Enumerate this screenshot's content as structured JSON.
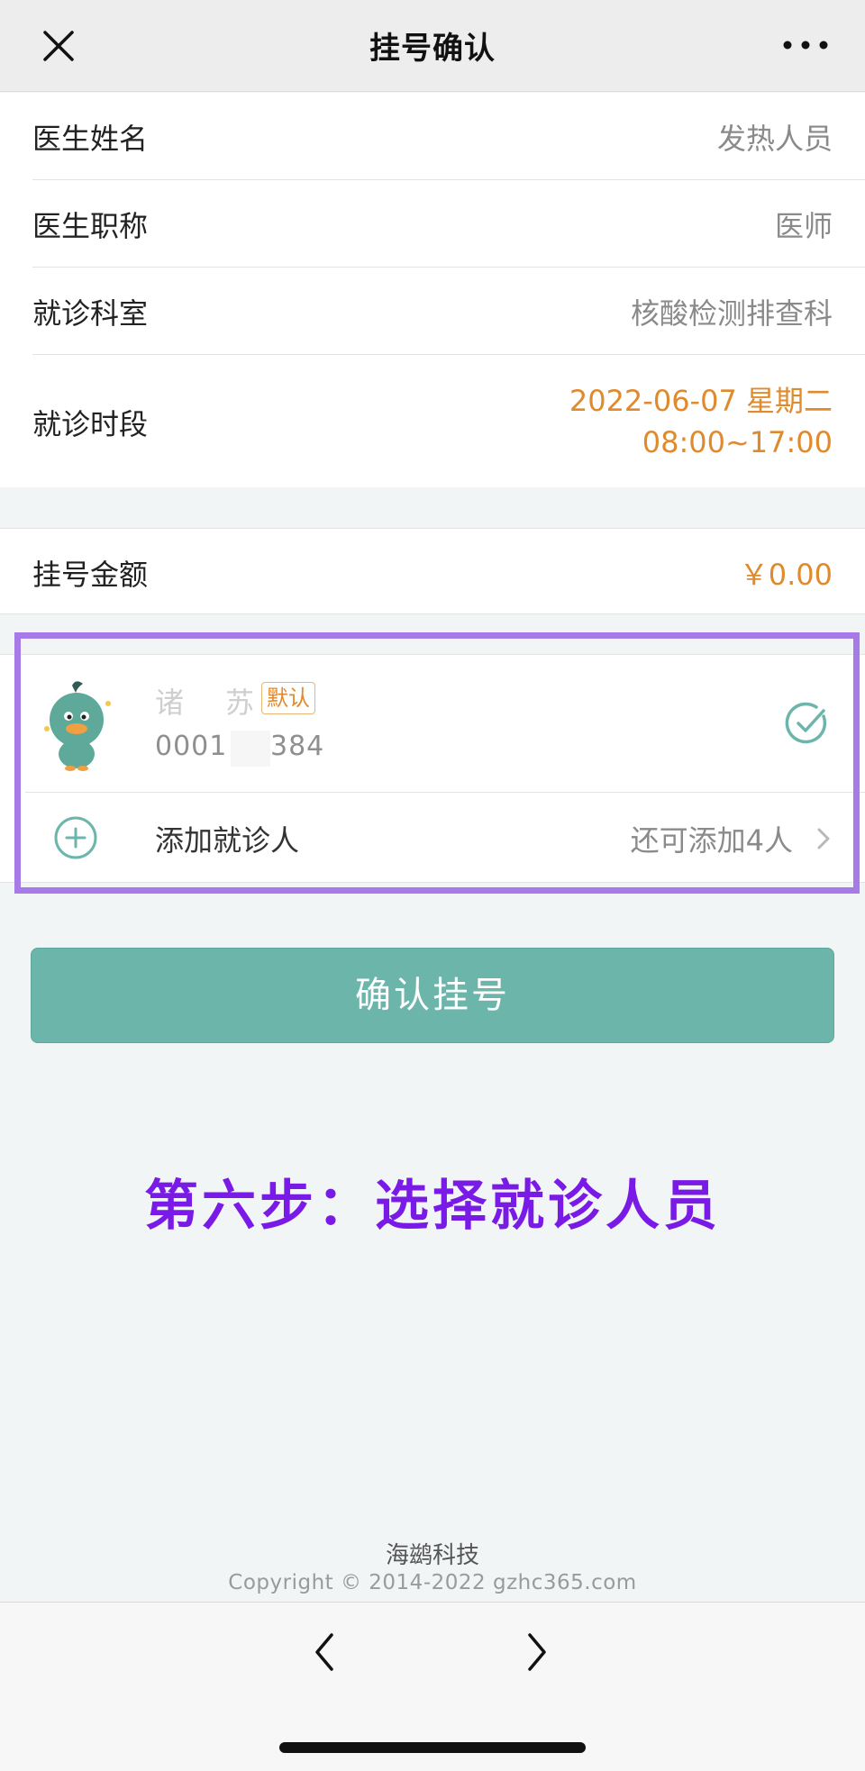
{
  "header": {
    "title": "挂号确认"
  },
  "details": [
    {
      "label": "医生姓名",
      "value": "发热人员"
    },
    {
      "label": "医生职称",
      "value": "医师"
    },
    {
      "label": "就诊科室",
      "value": "核酸检测排查科"
    }
  ],
  "time_slot": {
    "label": "就诊时段",
    "date": "2022-06-07 星期二",
    "hours": "08:00~17:00"
  },
  "fee": {
    "label": "挂号金额",
    "value": "￥0.00"
  },
  "patient": {
    "name_visible_first": "诸",
    "name_visible_last": "苏",
    "default_badge": "默认",
    "id_prefix": "0001",
    "id_suffix": "384"
  },
  "add_patient": {
    "label": "添加就诊人",
    "hint": "还可添加4人"
  },
  "confirm_button": "确认挂号",
  "annotation": "第六步：选择就诊人员",
  "footer": {
    "brand": "海鹚科技",
    "copyright": "Copyright © 2014-2022 gzhc365.com"
  },
  "colors": {
    "accent": "#6cb5ab",
    "highlight": "#e08a2e",
    "annotation": "#7a1ae6",
    "box_border": "#a67be8"
  },
  "icons": [
    "close-icon",
    "more-icon",
    "mascot-avatar",
    "check-circle-icon",
    "plus-circle-icon",
    "chevron-right-icon",
    "back-arrow-icon",
    "forward-arrow-icon"
  ]
}
